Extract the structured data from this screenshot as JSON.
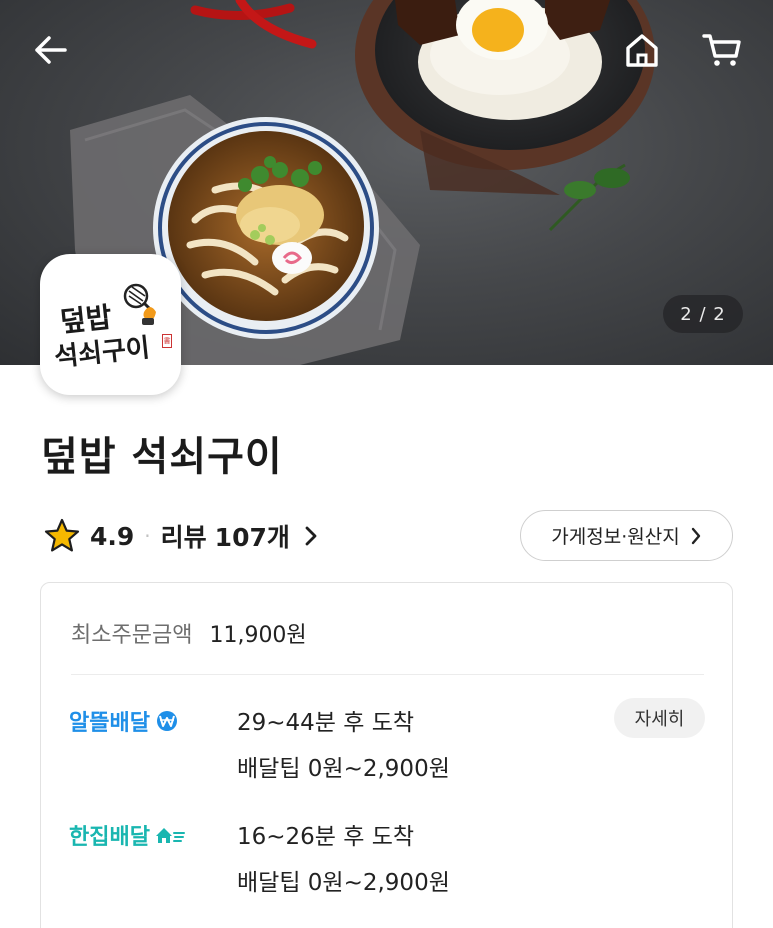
{
  "hero": {
    "pager": "2 / 2",
    "icons": {
      "back": "back-arrow-icon",
      "home": "home-icon",
      "cart": "cart-icon"
    }
  },
  "logo": {
    "line1": "덮밥",
    "line2": "석쇠구이",
    "seal": "書"
  },
  "store": {
    "name": "덮밥 석쇠구이",
    "rating": "4.9",
    "separator": "·",
    "review_label": "리뷰",
    "review_count": "107개",
    "info_button": "가게정보·원산지"
  },
  "card": {
    "min_order_label": "최소주문금액",
    "min_order_value": "11,900원",
    "deliveries": [
      {
        "name": "알뜰배달",
        "time": "29~44분 후 도착",
        "tip": "배달팁 0원~2,900원",
        "detail_button": "자세히",
        "color": "#1f8fe8"
      },
      {
        "name": "한집배달",
        "time": "16~26분 후 도착",
        "tip": "배달팁 0원~2,900원",
        "color": "#19b6b0"
      }
    ]
  },
  "colors": {
    "star": "#f5b800",
    "alttl": "#1f8fe8",
    "hanjip": "#19b6b0"
  }
}
